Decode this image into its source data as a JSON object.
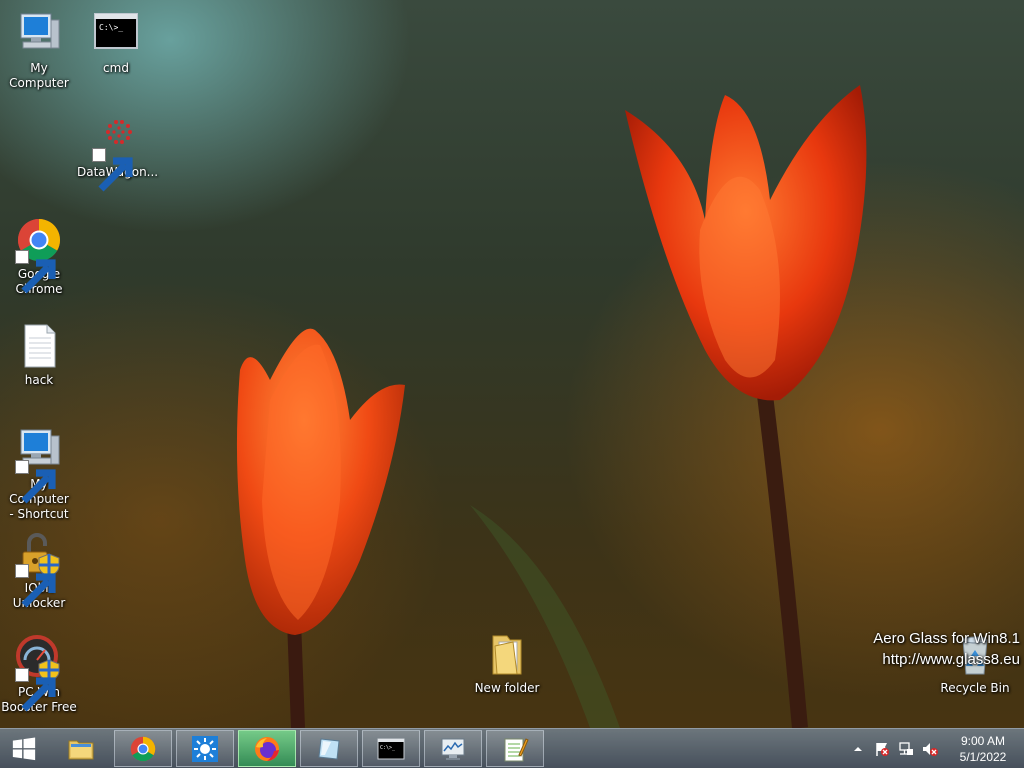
{
  "desktop": {
    "icons": [
      {
        "id": "my-computer",
        "label": "My Computer"
      },
      {
        "id": "cmd",
        "label": "cmd"
      },
      {
        "id": "datawagon",
        "label": "DataWagon..."
      },
      {
        "id": "google-chrome",
        "label": "Google Chrome",
        "label_lines": [
          "Google",
          "Chrome"
        ]
      },
      {
        "id": "hack",
        "label": "hack"
      },
      {
        "id": "my-computer-shortcut",
        "label": "My Computer - Shortcut",
        "label_lines": [
          "My Computer",
          "- Shortcut"
        ]
      },
      {
        "id": "iobit-unlocker",
        "label": "IObit Unlocker",
        "label_lines": [
          "IObit",
          "Unlocker"
        ]
      },
      {
        "id": "pc-win-booster",
        "label": "PC Win Booster Free",
        "label_lines": [
          "PC Win",
          "Booster Free"
        ]
      },
      {
        "id": "new-folder",
        "label": "New folder"
      },
      {
        "id": "recycle-bin",
        "label": "Recycle Bin"
      }
    ]
  },
  "watermark": {
    "line1": "Aero Glass for Win8.1",
    "line2": "http://www.glass8.eu"
  },
  "taskbar": {
    "start_icon": "windows-logo-icon",
    "pinned": [
      {
        "name": "file-explorer",
        "icon": "folder-icon"
      },
      {
        "name": "google-chrome",
        "icon": "chrome-icon"
      },
      {
        "name": "weather-app",
        "icon": "sun-icon"
      },
      {
        "name": "firefox",
        "icon": "firefox-icon",
        "active": true
      },
      {
        "name": "glass-app",
        "icon": "glass-pane-icon"
      },
      {
        "name": "command-prompt",
        "icon": "cmd-icon"
      },
      {
        "name": "performance-monitor",
        "icon": "monitor-graph-icon"
      },
      {
        "name": "notepad-plus-plus",
        "icon": "notepad-icon"
      }
    ],
    "tray": {
      "icons": [
        "show-hidden-icons-arrow",
        "action-center-flag-icon",
        "network-icon",
        "volume-muted-icon"
      ]
    },
    "clock": {
      "time": "9:00 AM",
      "date": "5/1/2022"
    }
  },
  "colors": {
    "taskbar_active": "#3cb464",
    "flower": "#e83a10"
  }
}
